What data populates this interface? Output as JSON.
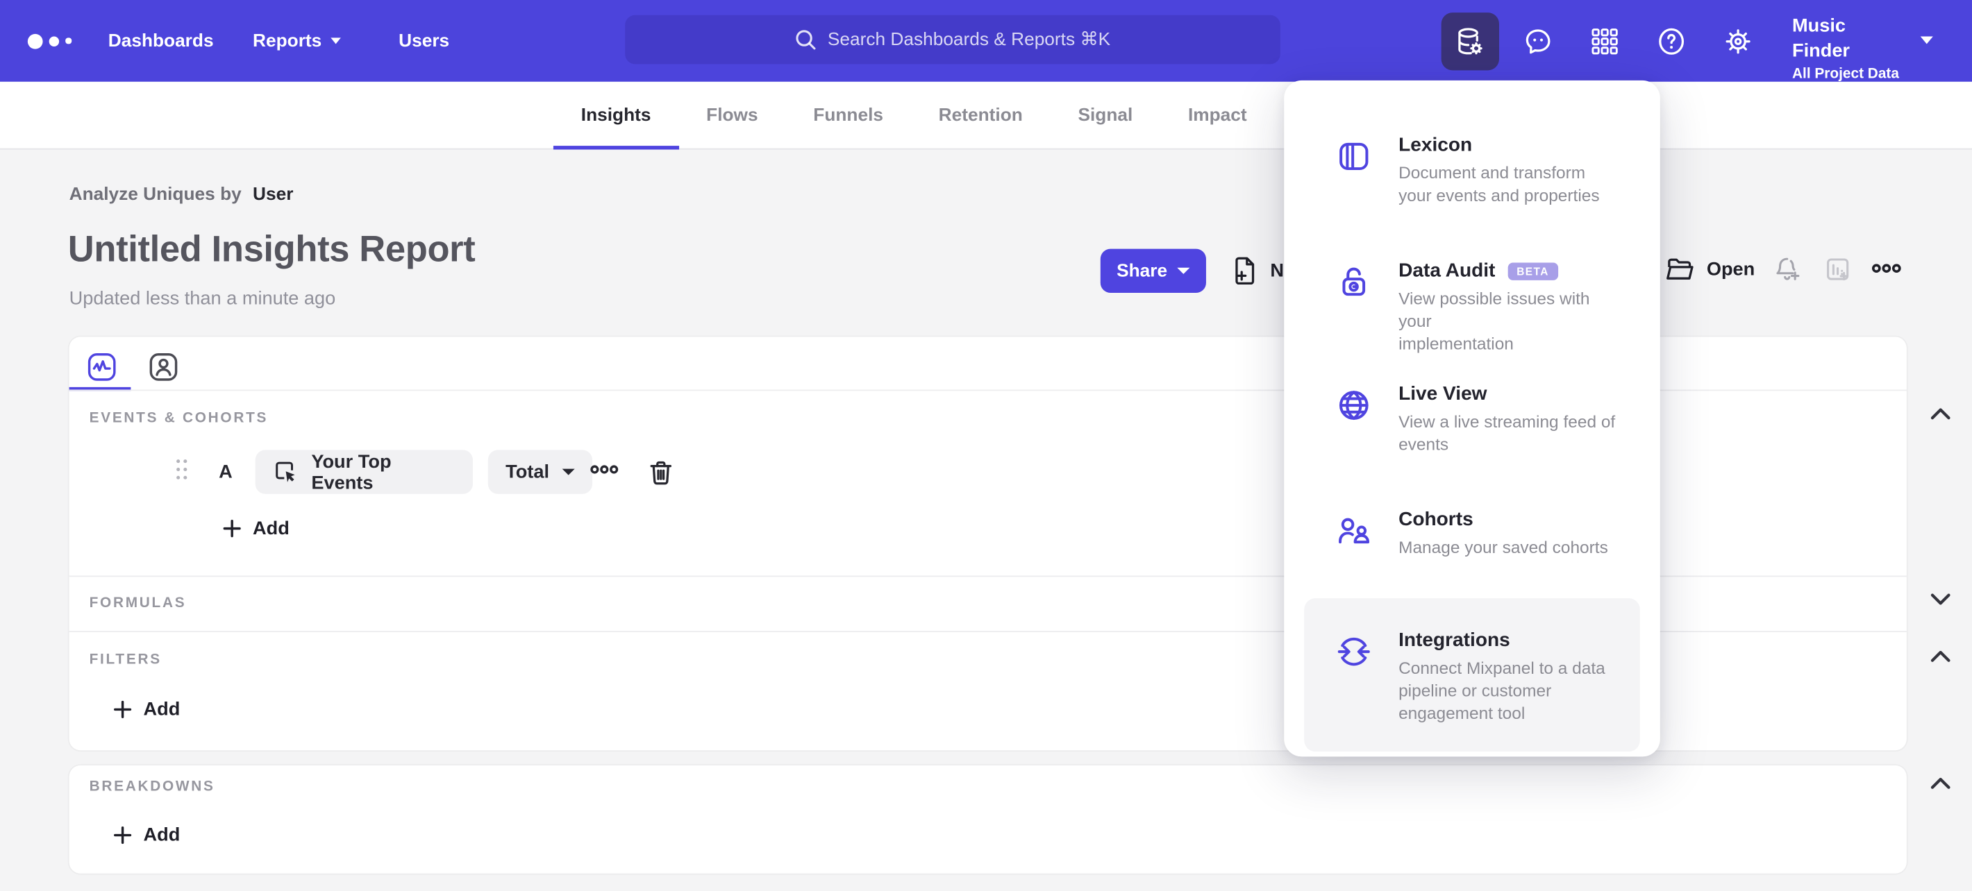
{
  "nav": {
    "items": [
      "Dashboards",
      "Reports",
      "Users"
    ],
    "search_placeholder": "Search Dashboards & Reports ⌘K",
    "project_name": "Music Finder",
    "project_scope": "All Project Data"
  },
  "tabs": {
    "items": [
      "Insights",
      "Flows",
      "Funnels",
      "Retention",
      "Signal",
      "Impact"
    ],
    "active": "Insights"
  },
  "report": {
    "breadcrumb_prefix": "Analyze Uniques by",
    "breadcrumb_value": "User",
    "title": "Untitled Insights Report",
    "updated": "Updated less than a minute ago"
  },
  "actions": {
    "share": "Share",
    "new": "New",
    "open": "Open"
  },
  "builder": {
    "events_header": "EVENTS & COHORTS",
    "row_label": "A",
    "event_name": "Your Top Events",
    "aggregation": "Total",
    "add_label": "Add",
    "formulas_header": "FORMULAS",
    "filters_header": "FILTERS",
    "breakdowns_header": "BREAKDOWNS"
  },
  "menu": {
    "items": [
      {
        "title": "Lexicon",
        "desc_lines": [
          "Document and transform",
          "your events and properties"
        ]
      },
      {
        "title": "Data Audit",
        "badge": "BETA",
        "desc_lines": [
          "View possible issues with your",
          "implementation"
        ]
      },
      {
        "title": "Live View",
        "desc_lines": [
          "View a live streaming feed of",
          "events"
        ]
      },
      {
        "title": "Cohorts",
        "desc_lines": [
          "Manage your saved cohorts"
        ]
      },
      {
        "title": "Integrations",
        "desc_lines": [
          "Connect Mixpanel to a data",
          "pipeline or customer",
          "engagement tool"
        ]
      }
    ]
  },
  "colors": {
    "accent": "#4f44e0",
    "nav": "#4c44dc",
    "beta_badge": "#a89fe8",
    "active_icon_bg": "#3a3278"
  }
}
